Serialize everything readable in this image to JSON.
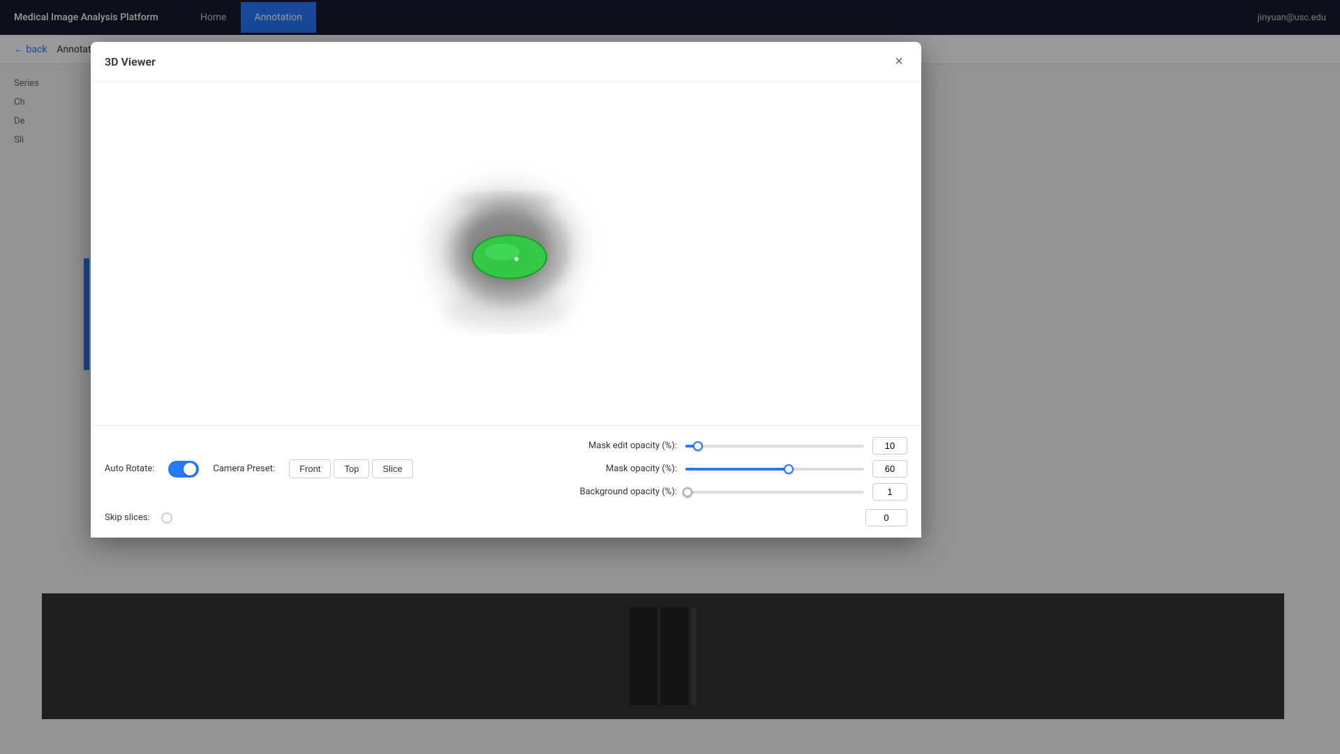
{
  "app": {
    "title": "Medical Image Analysis Platform",
    "nav": {
      "home": "Home",
      "annotation": "Annotation",
      "active": "annotation"
    },
    "user_email": "jinyuan@usc.edu"
  },
  "background_page": {
    "header_text": "Annotation Editor: Mask demo",
    "back_link": "back",
    "series_label": "Series",
    "channel_label": "Ch",
    "default_label": "De",
    "slices_label": "Sli"
  },
  "modal": {
    "title": "3D Viewer",
    "close_label": "×"
  },
  "controls": {
    "auto_rotate_label": "Auto Rotate:",
    "camera_preset_label": "Camera Preset:",
    "front_btn": "Front",
    "top_btn": "Top",
    "slice_btn": "Slice",
    "skip_slices_label": "Skip slices:",
    "skip_value": "0"
  },
  "sliders": {
    "mask_edit_opacity": {
      "label": "Mask edit opacity (%):",
      "value": 10,
      "fill_percent": 7,
      "thumb_percent": 7
    },
    "mask_opacity": {
      "label": "Mask opacity (%):",
      "value": 60,
      "fill_percent": 58,
      "thumb_percent": 58
    },
    "background_opacity": {
      "label": "Background opacity (%):",
      "value": 1,
      "fill_percent": 1,
      "thumb_percent": 1
    }
  }
}
